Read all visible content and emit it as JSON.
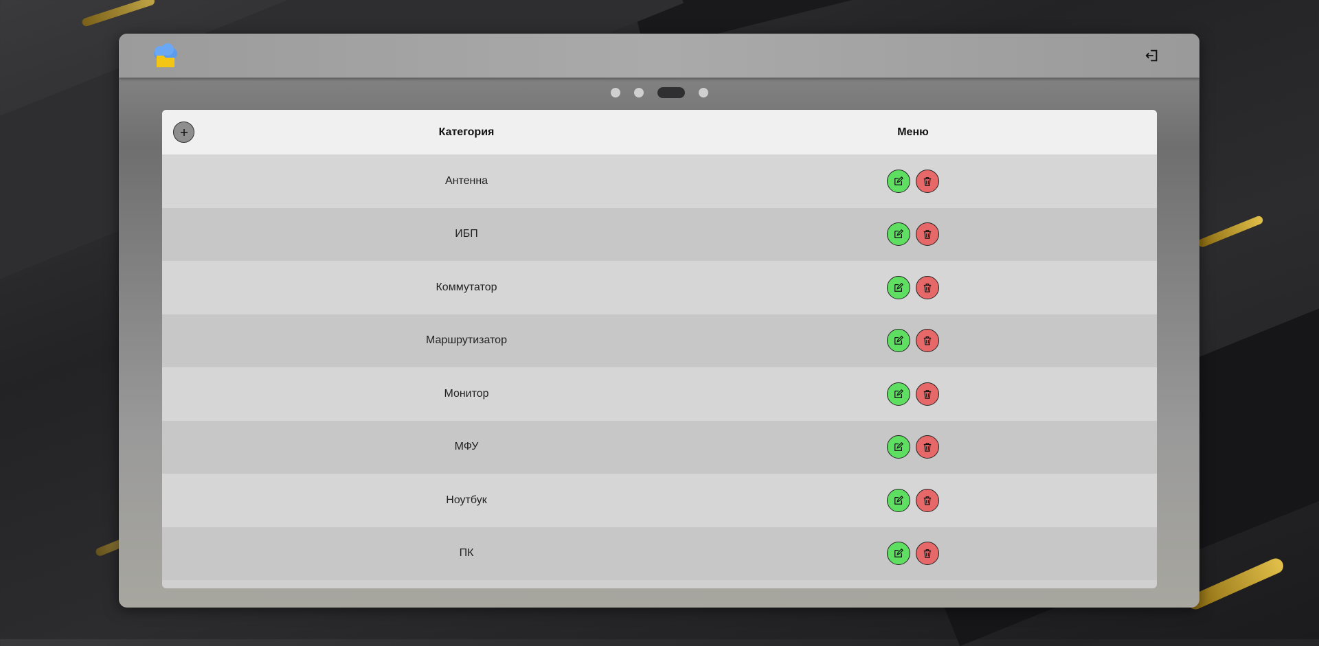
{
  "header": {
    "logo_icon": "cloud-folder-icon",
    "logout_icon": "logout-icon"
  },
  "pager": {
    "pages": 4,
    "active_index": 2
  },
  "table": {
    "add_icon": "plus-icon",
    "columns": [
      "Категория",
      "Меню"
    ],
    "rows": [
      {
        "category": "Антенна"
      },
      {
        "category": "ИБП"
      },
      {
        "category": "Коммутатор"
      },
      {
        "category": "Маршрутизатор"
      },
      {
        "category": "Монитор"
      },
      {
        "category": "МФУ"
      },
      {
        "category": "Ноутбук"
      },
      {
        "category": "ПК"
      }
    ],
    "row_actions": [
      {
        "icon": "edit-icon",
        "color": "#5fdf62"
      },
      {
        "icon": "trash-icon",
        "color": "#e76868"
      }
    ]
  },
  "colors": {
    "accent_gold": "#e2c04a",
    "edit_green": "#5fdf62",
    "delete_red": "#e76868"
  }
}
